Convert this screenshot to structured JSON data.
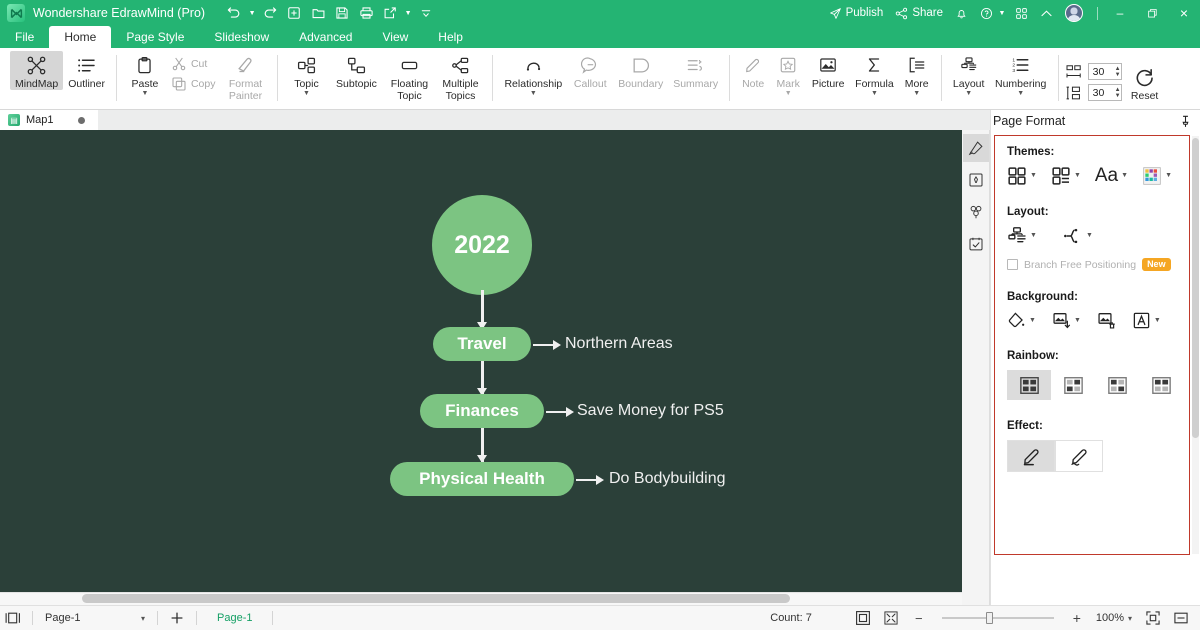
{
  "titlebar": {
    "app_title": "Wondershare EdrawMind (Pro)",
    "logo_icon": "edrawmind-logo-icon",
    "quick_access": [
      {
        "name": "undo",
        "icon": "undo-icon",
        "caret": true
      },
      {
        "name": "redo",
        "icon": "redo-icon",
        "caret": false
      },
      {
        "name": "new",
        "icon": "new-file-icon",
        "caret": false
      },
      {
        "name": "open",
        "icon": "open-folder-icon",
        "caret": false
      },
      {
        "name": "save",
        "icon": "save-disk-icon",
        "caret": false
      },
      {
        "name": "print",
        "icon": "printer-icon",
        "caret": false
      },
      {
        "name": "export",
        "icon": "export-share-icon",
        "caret": true
      },
      {
        "name": "more",
        "icon": "more-chevron-icon",
        "caret": false
      }
    ],
    "publish_label": "Publish",
    "share_label": "Share",
    "bell_icon": "notification-bell-icon",
    "help_icon": "help-circle-icon",
    "grid_icon": "apps-grid-icon",
    "collapse_icon": "collapse-ribbon-icon",
    "avatar_name": "user-avatar",
    "window": {
      "minimize": "–",
      "maximize": "❐",
      "close": "×"
    }
  },
  "menubar": {
    "items": [
      {
        "label": "File",
        "active": false
      },
      {
        "label": "Home",
        "active": true
      },
      {
        "label": "Page Style",
        "active": false
      },
      {
        "label": "Slideshow",
        "active": false
      },
      {
        "label": "Advanced",
        "active": false
      },
      {
        "label": "View",
        "active": false
      },
      {
        "label": "Help",
        "active": false
      }
    ]
  },
  "ribbon": {
    "view_group": [
      {
        "label": "MindMap",
        "icon": "mindmap-icon",
        "selected": true,
        "disabled": false
      },
      {
        "label": "Outliner",
        "icon": "outliner-list-icon",
        "selected": false,
        "disabled": false
      }
    ],
    "clipboard": {
      "paste_label": "Paste",
      "paste_icon": "clipboard-icon",
      "cut_label": "Cut",
      "cut_icon": "scissors-icon",
      "copy_label": "Copy",
      "copy_icon": "copy-icon",
      "format_painter_label_line1": "Format",
      "format_painter_label_line2": "Painter",
      "format_painter_icon": "format-painter-icon"
    },
    "topic_group": [
      {
        "label": "Topic",
        "icon": "topic-icon",
        "caret": true,
        "disabled": false
      },
      {
        "label": "Subtopic",
        "icon": "subtopic-icon",
        "caret": false,
        "disabled": false
      },
      {
        "label": "Floating Topic",
        "icon": "floating-topic-icon",
        "caret": false,
        "disabled": false
      },
      {
        "label": "Multiple Topics",
        "icon": "multiple-topics-icon",
        "caret": false,
        "disabled": false
      }
    ],
    "annotate_group": [
      {
        "label": "Relationship",
        "icon": "relationship-icon",
        "caret": true,
        "disabled": false
      },
      {
        "label": "Callout",
        "icon": "callout-icon",
        "caret": false,
        "disabled": true
      },
      {
        "label": "Boundary",
        "icon": "boundary-icon",
        "caret": false,
        "disabled": true
      },
      {
        "label": "Summary",
        "icon": "summary-icon",
        "caret": false,
        "disabled": true
      }
    ],
    "insert_group": [
      {
        "label": "Note",
        "icon": "note-pencil-icon",
        "caret": false,
        "disabled": true
      },
      {
        "label": "Mark",
        "icon": "mark-star-icon",
        "caret": true,
        "disabled": true
      },
      {
        "label": "Picture",
        "icon": "picture-icon",
        "caret": false,
        "disabled": false
      },
      {
        "label": "Formula",
        "icon": "formula-sigma-icon",
        "caret": true,
        "disabled": false
      },
      {
        "label": "More",
        "icon": "more-list-icon",
        "caret": true,
        "disabled": false
      }
    ],
    "layout_group": [
      {
        "label": "Layout",
        "icon": "layout-tree-icon",
        "caret": true
      },
      {
        "label": "Numbering",
        "icon": "numbering-icon",
        "caret": true
      }
    ],
    "spacing": {
      "horizontal_icon": "horizontal-spacing-icon",
      "horizontal_value": "30",
      "vertical_icon": "vertical-spacing-icon",
      "vertical_value": "30",
      "reset_label": "Reset",
      "reset_icon": "reset-circular-arrow-icon"
    }
  },
  "doc_tabs": [
    {
      "label": "Map1",
      "icon": "document-icon",
      "modified": true
    }
  ],
  "canvas": {
    "background_color": "#2b4039",
    "node_color": "#7cc482",
    "root": {
      "label": "2022"
    },
    "branches": [
      {
        "topic": "Travel",
        "leaf": "Northern Areas"
      },
      {
        "topic": "Finances",
        "leaf": "Save Money for PS5"
      },
      {
        "topic": "Physical Health",
        "leaf": "Do Bodybuilding"
      }
    ]
  },
  "rail": [
    {
      "name": "style-brush",
      "icon": "paint-brush-icon",
      "selected": true
    },
    {
      "name": "shape",
      "icon": "shape-frame-icon",
      "selected": false
    },
    {
      "name": "clipart",
      "icon": "clover-clipart-icon",
      "selected": false
    },
    {
      "name": "task",
      "icon": "task-calendar-icon",
      "selected": false
    }
  ],
  "panel": {
    "title": "Page Format",
    "pin_icon": "pin-icon",
    "themes": {
      "label": "Themes:",
      "items": [
        {
          "name": "theme-style",
          "icon": "theme-grid-icon",
          "caret": true
        },
        {
          "name": "theme-layout",
          "icon": "theme-list-icon",
          "caret": true
        },
        {
          "name": "theme-font",
          "icon": "font-Aa-icon",
          "caret": true,
          "glyph": "Aa"
        },
        {
          "name": "theme-color",
          "icon": "color-palette-icon",
          "caret": true
        }
      ]
    },
    "layout": {
      "label": "Layout:",
      "items": [
        {
          "name": "layout-org",
          "icon": "org-chart-icon",
          "caret": true
        },
        {
          "name": "layout-branch",
          "icon": "branch-map-icon",
          "caret": true
        }
      ],
      "checkbox_label": "Branch Free Positioning",
      "checkbox_checked": false,
      "badge": "New"
    },
    "background": {
      "label": "Background:",
      "items": [
        {
          "name": "bg-fill",
          "icon": "paint-bucket-icon",
          "caret": true
        },
        {
          "name": "bg-image",
          "icon": "image-insert-icon",
          "caret": true
        },
        {
          "name": "bg-remove",
          "icon": "image-delete-icon",
          "caret": false
        },
        {
          "name": "bg-watermark",
          "icon": "watermark-A-icon",
          "caret": true
        }
      ]
    },
    "rainbow": {
      "label": "Rainbow:",
      "items": [
        {
          "name": "rainbow-style-1",
          "icon": "rainbow-grid-icon",
          "selected": true
        },
        {
          "name": "rainbow-style-2",
          "icon": "rainbow-grid-icon",
          "selected": false
        },
        {
          "name": "rainbow-style-3",
          "icon": "rainbow-grid-icon",
          "selected": false
        },
        {
          "name": "rainbow-style-4",
          "icon": "rainbow-grid-icon",
          "selected": false
        }
      ]
    },
    "effect": {
      "label": "Effect:",
      "items": [
        {
          "name": "effect-straight",
          "icon": "pencil-straight-icon",
          "selected": true
        },
        {
          "name": "effect-sketch",
          "icon": "pencil-sketch-icon",
          "selected": false
        }
      ]
    }
  },
  "statusbar": {
    "view_icon": "page-view-icon",
    "page_select_value": "Page-1",
    "page_select_caret": "▾",
    "add_page_icon": "plus-icon",
    "active_page_chip": "Page-1",
    "count_label": "Count: 7",
    "fit_page_icon": "fit-page-icon",
    "full_screen_icon": "full-screen-icon",
    "zoom_minus": "−",
    "zoom_plus": "+",
    "zoom_level": "100%",
    "zoom_caret": "▾",
    "focus_icon": "focus-mode-icon",
    "collapse_icon": "collapse-panel-icon"
  }
}
